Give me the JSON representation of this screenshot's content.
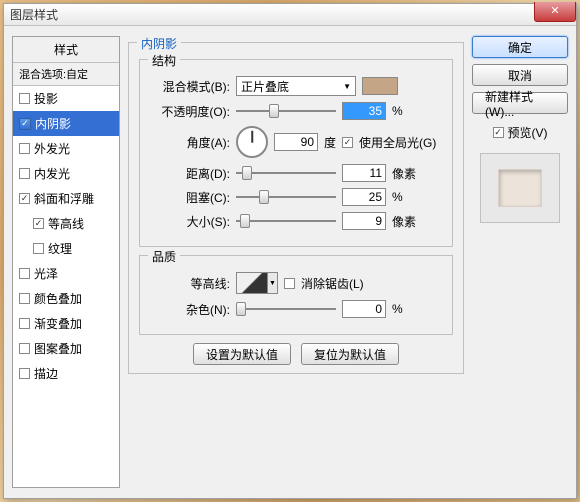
{
  "title": "图层样式",
  "left": {
    "header": "样式",
    "sub": "混合选项:自定",
    "items": [
      {
        "label": "投影",
        "checked": false,
        "active": false
      },
      {
        "label": "内阴影",
        "checked": true,
        "active": true
      },
      {
        "label": "外发光",
        "checked": false,
        "active": false
      },
      {
        "label": "内发光",
        "checked": false,
        "active": false
      },
      {
        "label": "斜面和浮雕",
        "checked": true,
        "active": false
      },
      {
        "label": "等高线",
        "checked": true,
        "active": false,
        "indent": true
      },
      {
        "label": "纹理",
        "checked": false,
        "active": false,
        "indent": true
      },
      {
        "label": "光泽",
        "checked": false,
        "active": false
      },
      {
        "label": "颜色叠加",
        "checked": false,
        "active": false
      },
      {
        "label": "渐变叠加",
        "checked": false,
        "active": false
      },
      {
        "label": "图案叠加",
        "checked": false,
        "active": false
      },
      {
        "label": "描边",
        "checked": false,
        "active": false
      }
    ]
  },
  "panel": {
    "title": "内阴影",
    "structure": {
      "title": "结构",
      "blend_label": "混合模式(B):",
      "blend_value": "正片叠底",
      "opacity_label": "不透明度(O):",
      "opacity_value": "35",
      "opacity_unit": "%",
      "angle_label": "角度(A):",
      "angle_value": "90",
      "angle_unit": "度",
      "global_label": "使用全局光(G)",
      "global_checked": true,
      "distance_label": "距离(D):",
      "distance_value": "11",
      "distance_unit": "像素",
      "choke_label": "阻塞(C):",
      "choke_value": "25",
      "choke_unit": "%",
      "size_label": "大小(S):",
      "size_value": "9",
      "size_unit": "像素"
    },
    "quality": {
      "title": "品质",
      "contour_label": "等高线:",
      "aa_label": "消除锯齿(L)",
      "aa_checked": false,
      "noise_label": "杂色(N):",
      "noise_value": "0",
      "noise_unit": "%"
    },
    "reset_default": "设置为默认值",
    "restore_default": "复位为默认值"
  },
  "right": {
    "ok": "确定",
    "cancel": "取消",
    "new_style": "新建样式(W)...",
    "preview_label": "预览(V)",
    "preview_checked": true
  },
  "colors": {
    "swatch": "#c4a586",
    "accent": "#3470d4"
  }
}
